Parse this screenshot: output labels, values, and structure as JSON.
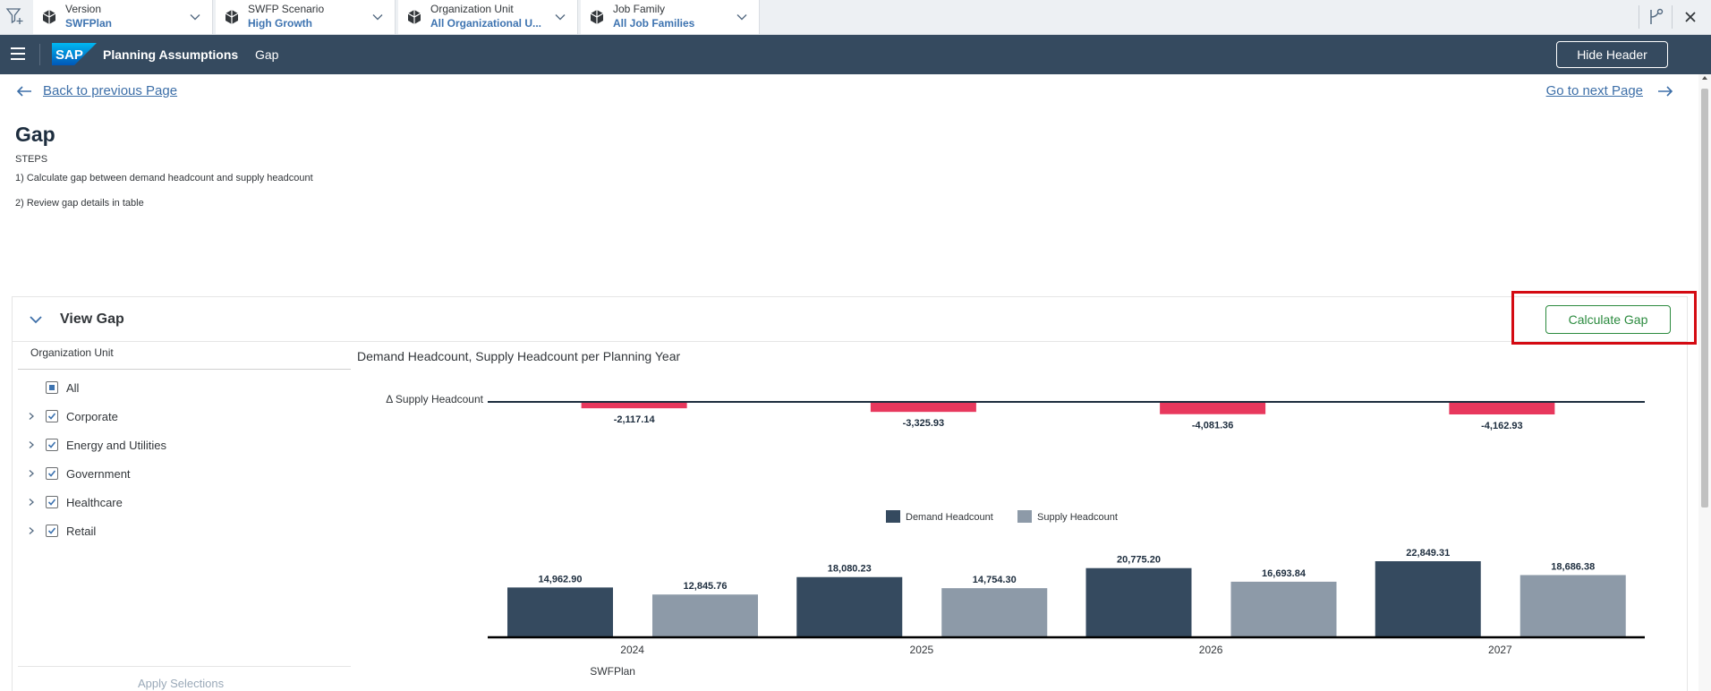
{
  "filter_bar": {
    "items": [
      {
        "label": "Version",
        "value": "SWFPlan"
      },
      {
        "label": "SWFP Scenario",
        "value": "High Growth"
      },
      {
        "label": "Organization Unit",
        "value": "All Organizational U..."
      },
      {
        "label": "Job Family",
        "value": "All Job Families"
      }
    ]
  },
  "shell": {
    "logo_text": "SAP",
    "title": "Planning Assumptions",
    "subtitle": "Gap",
    "hide_header": "Hide Header"
  },
  "page": {
    "back_link": "Back to previous Page",
    "next_link": "Go to next Page",
    "title": "Gap",
    "steps_label": "STEPS",
    "step1": "1) Calculate gap between demand headcount and supply headcount",
    "step2": "2) Review gap details in table"
  },
  "card": {
    "title": "View Gap",
    "calculate_button": "Calculate Gap"
  },
  "org_panel": {
    "title": "Organization Unit",
    "items": [
      {
        "label": "All",
        "state": "partial",
        "expandable": false
      },
      {
        "label": "Corporate",
        "state": "checked",
        "expandable": true
      },
      {
        "label": "Energy and Utilities",
        "state": "checked",
        "expandable": true
      },
      {
        "label": "Government",
        "state": "checked",
        "expandable": true
      },
      {
        "label": "Healthcare",
        "state": "checked",
        "expandable": true
      },
      {
        "label": "Retail",
        "state": "checked",
        "expandable": true
      }
    ],
    "apply_button": "Apply Selections"
  },
  "colors": {
    "demand": "#354a5f",
    "supply": "#8d9aa8",
    "delta": "#e8385d",
    "shell": "#354a5f",
    "highlight": "#d40a12"
  },
  "chart_data": {
    "type": "bar",
    "title": "Demand Headcount, Supply Headcount per Planning Year",
    "categories": [
      "2024",
      "2025",
      "2026",
      "2027"
    ],
    "category_group_label": "SWFPlan",
    "series": [
      {
        "name": "Demand Headcount",
        "values": [
          14962.9,
          18080.23,
          20775.2,
          22849.31
        ],
        "labels": [
          "14,962.90",
          "18,080.23",
          "20,775.20",
          "22,849.31"
        ]
      },
      {
        "name": "Supply Headcount",
        "values": [
          12845.76,
          14754.3,
          16693.84,
          18686.38
        ],
        "labels": [
          "12,845.76",
          "14,754.30",
          "16,693.84",
          "18,686.38"
        ]
      }
    ],
    "delta": {
      "name": "Δ Supply Headcount",
      "values": [
        -2117.14,
        -3325.93,
        -4081.36,
        -4162.93
      ],
      "labels": [
        "-2,117.14",
        "-3,325.93",
        "-4,081.36",
        "-4,162.93"
      ]
    },
    "legend_position": "top-center",
    "grid": false
  }
}
